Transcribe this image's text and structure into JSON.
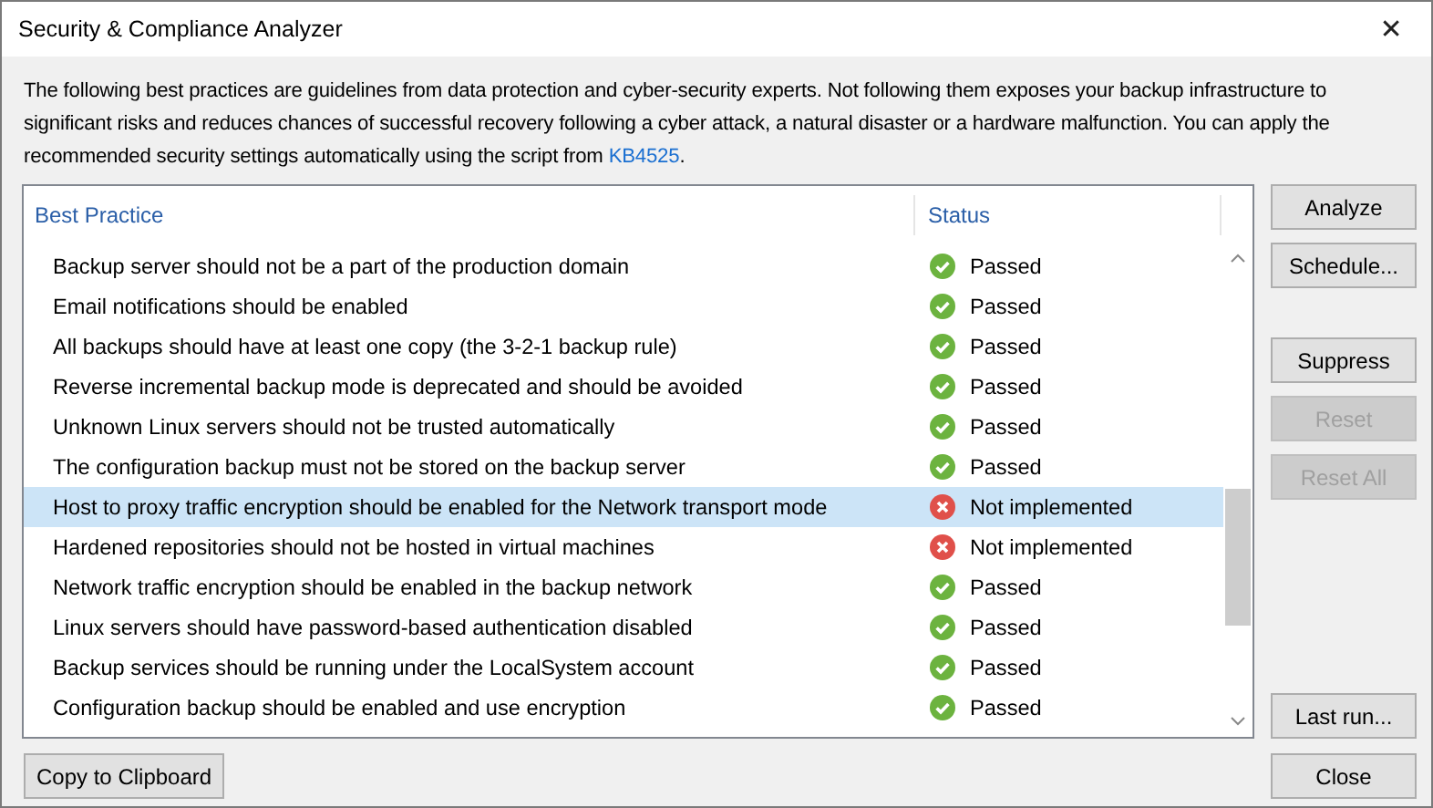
{
  "window": {
    "title": "Security & Compliance Analyzer",
    "close": "✕"
  },
  "description": {
    "text": "The following best practices are guidelines from data protection and cyber-security experts. Not following them exposes your backup infrastructure to significant risks and reduces chances of successful recovery following a cyber attack, a natural disaster or a hardware malfunction. You can apply the recommended security settings automatically using the script from ",
    "link": "KB4525",
    "end": "."
  },
  "table": {
    "columns": [
      "Best Practice",
      "Status"
    ],
    "rows": [
      {
        "practice": "Backup server should not be a part of the production domain",
        "status": "Passed",
        "kind": "passed",
        "selected": false
      },
      {
        "practice": "Email notifications should be enabled",
        "status": "Passed",
        "kind": "passed",
        "selected": false
      },
      {
        "practice": "All backups should have at least one copy (the 3-2-1 backup rule)",
        "status": "Passed",
        "kind": "passed",
        "selected": false
      },
      {
        "practice": "Reverse incremental backup mode is deprecated and should be avoided",
        "status": "Passed",
        "kind": "passed",
        "selected": false
      },
      {
        "practice": "Unknown Linux servers should not be trusted automatically",
        "status": "Passed",
        "kind": "passed",
        "selected": false
      },
      {
        "practice": "The configuration backup must not be stored on the backup server",
        "status": "Passed",
        "kind": "passed",
        "selected": false
      },
      {
        "practice": "Host to proxy traffic encryption should be enabled for the Network transport mode",
        "status": "Not implemented",
        "kind": "failed",
        "selected": true
      },
      {
        "practice": "Hardened repositories should not be hosted in virtual machines",
        "status": "Not implemented",
        "kind": "failed",
        "selected": false
      },
      {
        "practice": "Network traffic encryption should be enabled in the backup network",
        "status": "Passed",
        "kind": "passed",
        "selected": false
      },
      {
        "practice": "Linux servers should have password-based authentication disabled",
        "status": "Passed",
        "kind": "passed",
        "selected": false
      },
      {
        "practice": "Backup services should be running under the LocalSystem account",
        "status": "Passed",
        "kind": "passed",
        "selected": false
      },
      {
        "practice": "Configuration backup should be enabled and use encryption",
        "status": "Passed",
        "kind": "passed",
        "selected": false
      }
    ]
  },
  "top_buttons": [
    {
      "label": "Analyze",
      "disabled": false
    },
    {
      "label": "Schedule...",
      "disabled": false
    }
  ],
  "middle_buttons": [
    {
      "label": "Suppress",
      "disabled": false
    },
    {
      "label": "Reset",
      "disabled": true
    },
    {
      "label": "Reset All",
      "disabled": true
    }
  ],
  "bottom_buttons": [
    {
      "label": "Last run...",
      "disabled": false
    }
  ],
  "footer": {
    "copy": "Copy to Clipboard",
    "close": "Close"
  }
}
